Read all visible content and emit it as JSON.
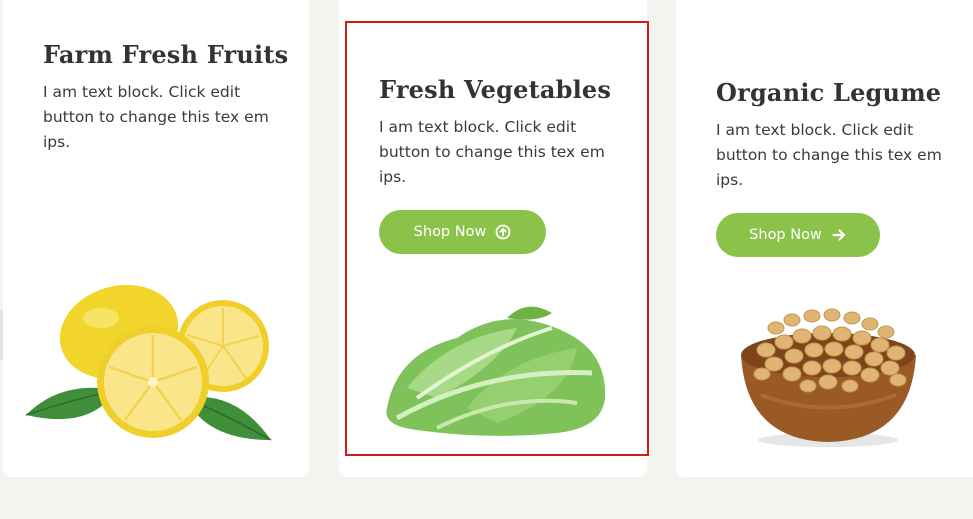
{
  "cards": [
    {
      "title": "Farm Fresh Fruits",
      "description": "I am text block. Click edit button to change this tex em ips.",
      "image": "lemons-image"
    },
    {
      "title": "Fresh Vegetables",
      "description": "I am text block. Click edit button to change this tex em ips.",
      "button_label": "Shop Now",
      "button_icon": "arrow-up-circle-icon",
      "image": "lettuce-image",
      "selected": true
    },
    {
      "title": "Organic Legume",
      "description": "I am text block. Click edit button to change this tex em ips.",
      "button_label": "Shop Now",
      "button_icon": "arrow-right-icon",
      "image": "soybean-bowl-image"
    }
  ],
  "colors": {
    "button": "#8bc34a",
    "selection_outline": "#d61a1a",
    "page_background": "#f3f3f0",
    "card_background": "#ffffff"
  }
}
